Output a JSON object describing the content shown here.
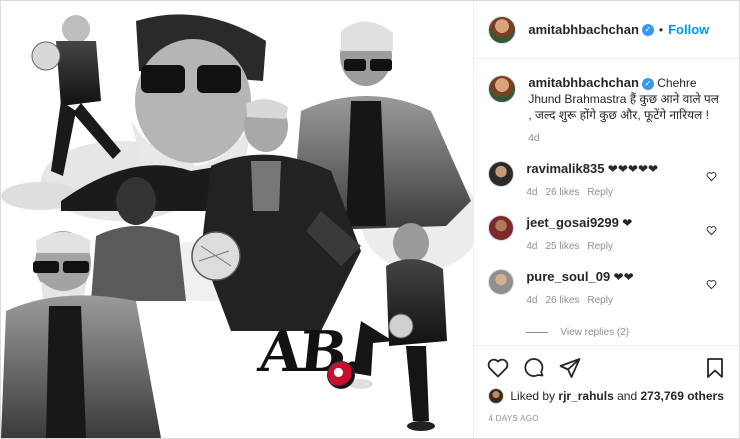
{
  "media": {
    "logo_text": "AB.",
    "description_alt": "Collage of black and white photos"
  },
  "header": {
    "username": "amitabhbachchan",
    "separator": "•",
    "follow_label": "Follow"
  },
  "caption": {
    "username": "amitabhbachchan",
    "text": "Chehre Jhund Brahmastra हैं कुछ आने वाले पल , जल्द शुरू होंगे कुछ और, फूटेंगे नारियल !",
    "age": "4d"
  },
  "comments": [
    {
      "username": "ravimalik835",
      "text": "❤❤❤❤❤",
      "age": "4d",
      "likes": "26 likes",
      "reply": "Reply"
    },
    {
      "username": "jeet_gosai9299",
      "text": "❤",
      "age": "4d",
      "likes": "25 likes",
      "reply": "Reply"
    },
    {
      "username": "pure_soul_09",
      "text": "❤❤",
      "age": "4d",
      "likes": "26 likes",
      "reply": "Reply"
    }
  ],
  "view_replies": "View replies (2)",
  "footer": {
    "liked_prefix": "Liked by ",
    "liked_user": "rjr_rahuls",
    "liked_and": " and ",
    "liked_count": "273,769 others",
    "timestamp": "4 days ago"
  },
  "colors": {
    "accent": "#0095f6",
    "verified": "#3897f0",
    "muted": "#8e8e8e"
  },
  "icons": [
    "verified-badge-icon",
    "heart-icon",
    "comment-icon",
    "share-icon",
    "bookmark-icon"
  ]
}
